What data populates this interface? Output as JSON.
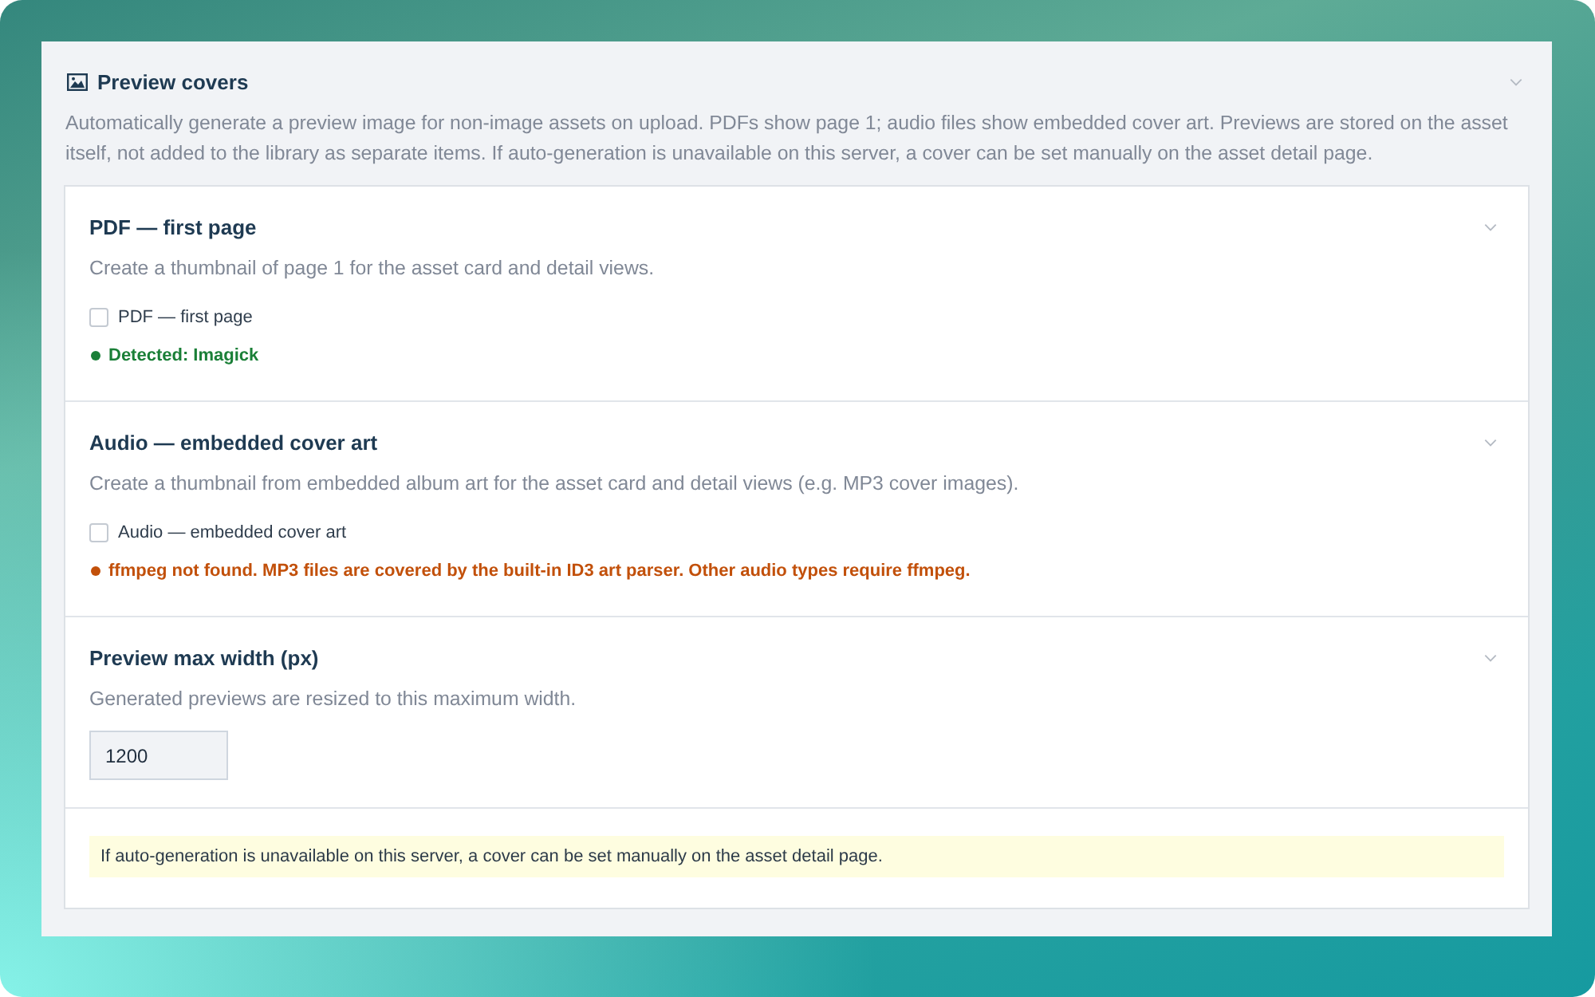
{
  "panel": {
    "title": "Preview covers",
    "description": "Automatically generate a preview image for non-image assets on upload. PDFs show page 1; audio files show embedded cover art. Previews are stored on the asset itself, not added to the library as separate items. If auto-generation is unavailable on this server, a cover can be set manually on the asset detail page."
  },
  "sections": [
    {
      "kind": "checkbox",
      "title": "PDF — first page",
      "description": "Create a thumbnail of page 1 for the asset card and detail views.",
      "checkbox": {
        "label": "PDF — first page",
        "checked": false
      },
      "status": {
        "text": "Detected: Imagick",
        "color": "#1a7f37"
      }
    },
    {
      "kind": "checkbox",
      "title": "Audio — embedded cover art",
      "description": "Create a thumbnail from embedded album art for the asset card and detail views (e.g. MP3 cover images).",
      "checkbox": {
        "label": "Audio — embedded cover art",
        "checked": false
      },
      "status": {
        "text": "ffmpeg not found. MP3 files are covered by the built-in ID3 art parser. Other audio types require ffmpeg.",
        "color": "#c2500a"
      }
    },
    {
      "kind": "number",
      "title": "Preview max width (px)",
      "description": "Generated previews are resized to this maximum width.",
      "field": {
        "value": "1200"
      }
    }
  ],
  "notice": "If auto-generation is unavailable on this server, a cover can be set manually on the asset detail page."
}
